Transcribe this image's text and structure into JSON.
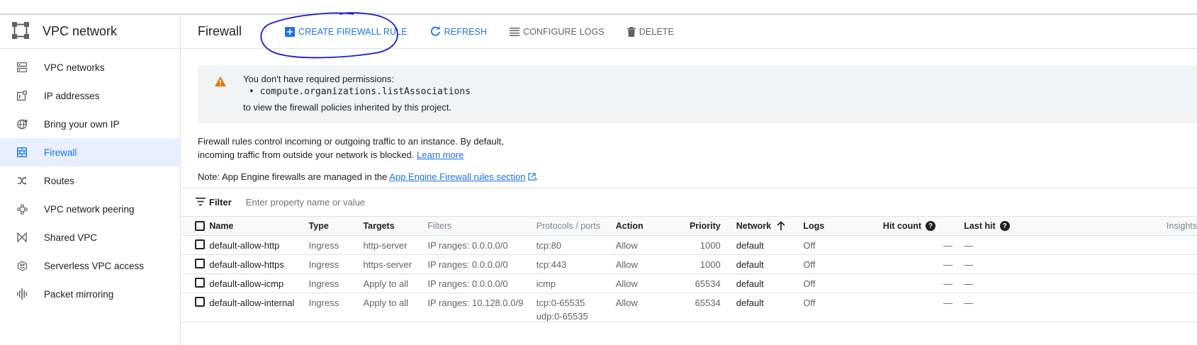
{
  "sidebar": {
    "title": "VPC network",
    "items": [
      {
        "label": "VPC networks",
        "icon": "vpc-networks-icon"
      },
      {
        "label": "IP addresses",
        "icon": "ip-addresses-icon"
      },
      {
        "label": "Bring your own IP",
        "icon": "globe-icon"
      },
      {
        "label": "Firewall",
        "icon": "firewall-icon",
        "active": true
      },
      {
        "label": "Routes",
        "icon": "routes-icon"
      },
      {
        "label": "VPC network peering",
        "icon": "peering-icon"
      },
      {
        "label": "Shared VPC",
        "icon": "shared-vpc-icon"
      },
      {
        "label": "Serverless VPC access",
        "icon": "serverless-icon"
      },
      {
        "label": "Packet mirroring",
        "icon": "packet-mirroring-icon"
      }
    ]
  },
  "toolbar": {
    "title": "Firewall",
    "create": "CREATE FIREWALL RULE",
    "refresh": "REFRESH",
    "configure_logs": "CONFIGURE LOGS",
    "delete": "DELETE"
  },
  "warning": {
    "line1": "You don't have required permissions:",
    "bullet": "•  compute.organizations.listAssociations",
    "line3": "to view the firewall policies inherited by this project."
  },
  "description": {
    "text": "Firewall rules control incoming or outgoing traffic to an instance. By default, incoming traffic from outside your network is blocked. ",
    "link": "Learn more"
  },
  "note": {
    "prefix": "Note: App Engine firewalls are managed in the ",
    "link": "App Engine Firewall rules section",
    "suffix": "."
  },
  "filter": {
    "label": "Filter",
    "placeholder": "Enter property name or value"
  },
  "table": {
    "headers": {
      "name": "Name",
      "type": "Type",
      "targets": "Targets",
      "filters": "Filters",
      "protocols": "Protocols / ports",
      "action": "Action",
      "priority": "Priority",
      "network": "Network",
      "logs": "Logs",
      "hit_count": "Hit count",
      "last_hit": "Last hit",
      "insights": "Insights"
    },
    "rows": [
      {
        "name": "default-allow-http",
        "type": "Ingress",
        "targets": "http-server",
        "filters": "IP ranges: 0.0.0.0/0",
        "protocols": "tcp:80",
        "protocols2": "",
        "action": "Allow",
        "priority": "1000",
        "network": "default",
        "logs": "Off",
        "hit_count": "—",
        "last_hit": "—"
      },
      {
        "name": "default-allow-https",
        "type": "Ingress",
        "targets": "https-server",
        "filters": "IP ranges: 0.0.0.0/0",
        "protocols": "tcp:443",
        "protocols2": "",
        "action": "Allow",
        "priority": "1000",
        "network": "default",
        "logs": "Off",
        "hit_count": "—",
        "last_hit": "—"
      },
      {
        "name": "default-allow-icmp",
        "type": "Ingress",
        "targets": "Apply to all",
        "filters": "IP ranges: 0.0.0.0/0",
        "protocols": "icmp",
        "protocols2": "",
        "action": "Allow",
        "priority": "65534",
        "network": "default",
        "logs": "Off",
        "hit_count": "—",
        "last_hit": "—"
      },
      {
        "name": "default-allow-internal",
        "type": "Ingress",
        "targets": "Apply to all",
        "filters": "IP ranges: 10.128.0.0/9",
        "protocols": "tcp:0-65535",
        "protocols2": "udp:0-65535",
        "action": "Allow",
        "priority": "65534",
        "network": "default",
        "logs": "Off",
        "hit_count": "—",
        "last_hit": "—"
      }
    ]
  },
  "colors": {
    "accent": "#1a73e8",
    "warning": "#e37400",
    "annotation": "#1a1ad6"
  }
}
